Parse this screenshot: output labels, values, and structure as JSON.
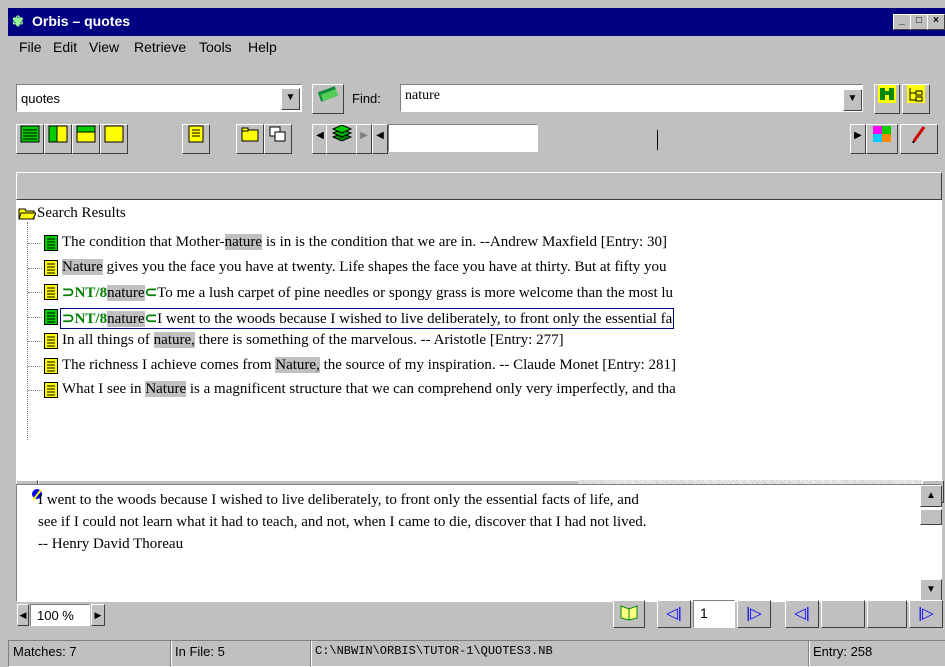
{
  "window": {
    "title": "Orbis – quotes"
  },
  "menu": [
    "File",
    "Edit",
    "View",
    "Retrieve",
    "Tools",
    "Help"
  ],
  "toolbar": {
    "database_value": "quotes",
    "find_label": "Find:",
    "find_value": "nature"
  },
  "tree": {
    "root_label": "Search Results",
    "results": [
      {
        "pre": "The condition that Mother-",
        "match": "nature",
        "post": " is in is the condition that we are in. --Andrew Maxfield  [Entry: 30]",
        "tag": "",
        "icon": "green"
      },
      {
        "pre": "",
        "match": "Nature",
        "post": " gives you the face you have at twenty. Life shapes the face you have at thirty. But at fifty you",
        "tag": "",
        "icon": "yellow"
      },
      {
        "pre": "",
        "match": "nature",
        "post": "To me a lush carpet of pine needles or spongy grass is more welcome than the most lu",
        "tag": "⊃NT/8",
        "icon": "yellow"
      },
      {
        "pre": "",
        "match": "nature",
        "post": "I went to the woods because I wished to live deliberately, to front only the essential fa",
        "tag": "⊃NT/8",
        "icon": "green"
      },
      {
        "pre": "In all things of ",
        "match": "nature,",
        "post": " there is something of the marvelous. -- Aristotle [Entry: 277]",
        "tag": "",
        "icon": "yellow"
      },
      {
        "pre": "The richness I achieve comes from ",
        "match": "Nature,",
        "post": " the source of my inspiration. -- Claude Monet [Entry: 281]",
        "tag": "",
        "icon": "yellow"
      },
      {
        "pre": "What I see in ",
        "match": "Nature",
        "post": " is a magnificent structure that we can comprehend only very imperfectly, and tha",
        "tag": "",
        "icon": "yellow"
      }
    ]
  },
  "detail": {
    "lines": [
      "I went to the woods because I wished to live deliberately, to front only the essential facts of life, and",
      "see if I could not learn what it had to teach, and not, when I came to die, discover that I had not lived.",
      "-- Henry David Thoreau"
    ]
  },
  "nav": {
    "zoom": "100 %",
    "page": "1"
  },
  "status": {
    "matches": "Matches: 7",
    "in_file": "In File: 5",
    "path": "C:\\NBWIN\\ORBIS\\TUTOR-1\\QUOTES3.NB",
    "entry": "Entry: 258"
  },
  "colors": {
    "title_bg": "#000080",
    "highlight": "#c0c0c0",
    "tag_green": "#008000"
  }
}
